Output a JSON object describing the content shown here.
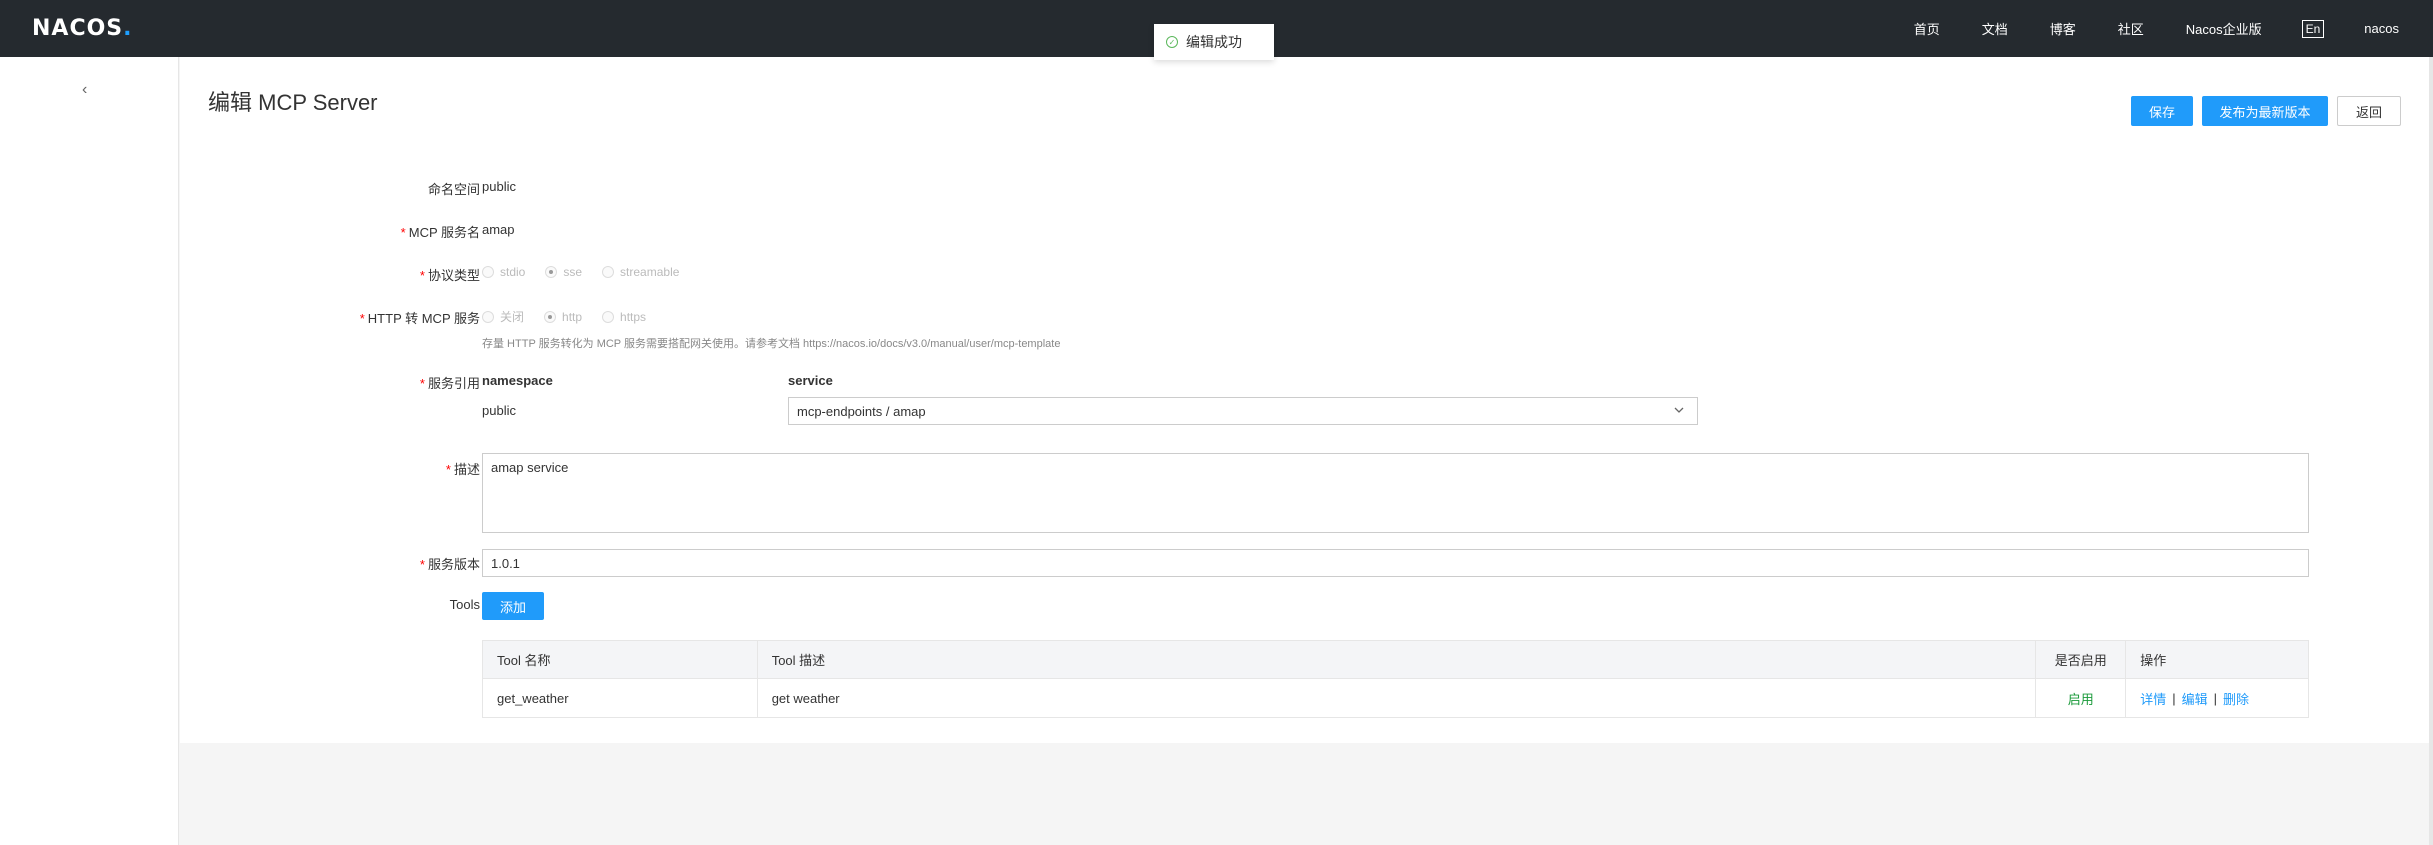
{
  "header": {
    "logo_text": "NACOS",
    "logo_dot": ".",
    "nav": [
      "首页",
      "文档",
      "博客",
      "社区",
      "Nacos企业版"
    ],
    "lang": "En",
    "user": "nacos"
  },
  "toast": {
    "text": "编辑成功"
  },
  "sidebar": {
    "collapse_glyph": "‹"
  },
  "page": {
    "title": "编辑 MCP Server",
    "buttons": {
      "save": "保存",
      "publish": "发布为最新版本",
      "back": "返回"
    }
  },
  "form": {
    "namespace": {
      "label": "命名空间",
      "value": "public"
    },
    "service_name": {
      "label": "MCP 服务名",
      "value": "amap"
    },
    "protocol": {
      "label": "协议类型",
      "options": [
        "stdio",
        "sse",
        "streamable"
      ],
      "selected": "sse"
    },
    "http_to_mcp": {
      "label": "HTTP 转 MCP 服务",
      "options": [
        "关闭",
        "http",
        "https"
      ],
      "selected": "http",
      "hint": "存量 HTTP 服务转化为 MCP 服务需要搭配网关使用。请参考文档 https://nacos.io/docs/v3.0/manual/user/mcp-template"
    },
    "service_ref": {
      "label": "服务引用",
      "namespace_head": "namespace",
      "service_head": "service",
      "namespace_value": "public",
      "service_value": "mcp-endpoints / amap"
    },
    "description": {
      "label": "描述",
      "value": "amap service"
    },
    "version": {
      "label": "服务版本",
      "value": "1.0.1"
    },
    "tools": {
      "label": "Tools",
      "add_label": "添加"
    }
  },
  "tools_table": {
    "headers": [
      "Tool 名称",
      "Tool 描述",
      "是否启用",
      "操作"
    ],
    "rows": [
      {
        "name": "get_weather",
        "desc": "get weather",
        "status": "启用",
        "actions": [
          "详情",
          "编辑",
          "删除"
        ]
      }
    ]
  },
  "colors": {
    "primary": "#209bfa",
    "topbar": "#252a2f",
    "required": "#ff0000",
    "enabled": "#1a9a3a"
  }
}
